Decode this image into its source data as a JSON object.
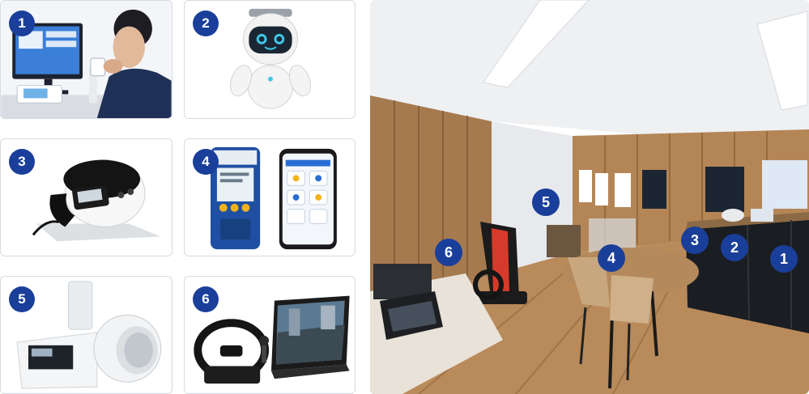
{
  "colors": {
    "badge": "#1a3f9a",
    "badge_text": "#ffffff",
    "card_border": "#d6d9de"
  },
  "products": [
    {
      "number": "1",
      "illustration": "breath-analyzer-pc-icon"
    },
    {
      "number": "2",
      "illustration": "robot-icon"
    },
    {
      "number": "3",
      "illustration": "alcohol-checker-device-icon"
    },
    {
      "number": "4",
      "illustration": "handheld-device-and-phone-icon"
    },
    {
      "number": "5",
      "illustration": "blood-pressure-monitor-icon"
    },
    {
      "number": "6",
      "illustration": "driving-simulator-icon"
    }
  ],
  "room_markers": [
    "1",
    "2",
    "3",
    "4",
    "5",
    "6"
  ]
}
